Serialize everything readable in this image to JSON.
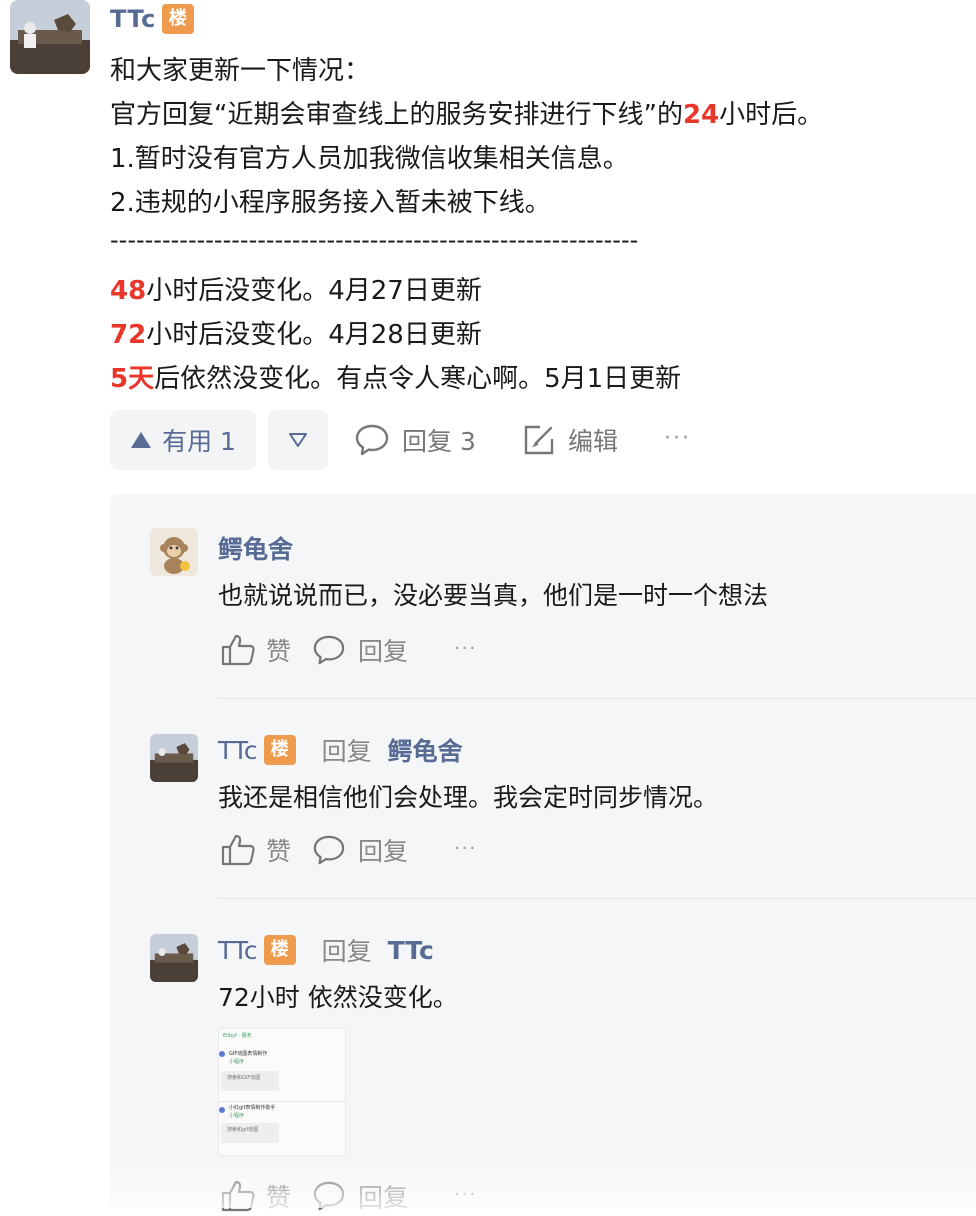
{
  "post": {
    "author": "TTc",
    "badge": "楼",
    "lines": {
      "l1": "和大家更新一下情况：",
      "l2_pre": "官方回复“近期会审查线上的服务安排进行下线”的",
      "l2_num": "24",
      "l2_post": "小时后。",
      "l3": "1.暂时没有官方人员加我微信收集相关信息。",
      "l4": "2.违规的小程序服务接入暂未被下线。",
      "divider": "-------------------------------------------------------------",
      "u1_num": "48",
      "u1_text": "小时后没变化。4月27日更新",
      "u2_num": "72",
      "u2_text": "小时后没变化。4月28日更新",
      "u3_num": "5天",
      "u3_text": "后依然没变化。有点令人寒心啊。5月1日更新"
    },
    "actions": {
      "useful": "有用 1",
      "reply": "回复 3",
      "edit": "编辑",
      "more": "···"
    }
  },
  "replies": [
    {
      "author": "鳄龟舍",
      "text": "也就说说而已，没必要当真，他们是一时一个想法",
      "like": "赞",
      "reply": "回复",
      "more": "···"
    },
    {
      "author": "TTc",
      "badge": "楼",
      "reply_word": "回复",
      "reply_to": "鳄龟舍",
      "text": "我还是相信他们会处理。我会定时同步情况。",
      "like": "赞",
      "reply": "回复",
      "more": "···"
    },
    {
      "author": "TTc",
      "badge": "楼",
      "reply_word": "回复",
      "reply_to": "TTc",
      "text": "72小时 依然没变化。",
      "like": "赞",
      "reply": "回复",
      "more": "···",
      "thumbnail": {
        "title": "Ellbyf · 服务",
        "item1_title": "GIF动图表情制作",
        "item1_sub": "小程序",
        "item1_btn": "搜索和GIF动图",
        "item2_title": "小红gif表情制作助手",
        "item2_sub": "小程序",
        "item2_btn": "搜索和gif动图"
      }
    }
  ],
  "colors": {
    "link": "#576b95",
    "highlight": "#e8362b",
    "badge": "#ee9b4d"
  }
}
